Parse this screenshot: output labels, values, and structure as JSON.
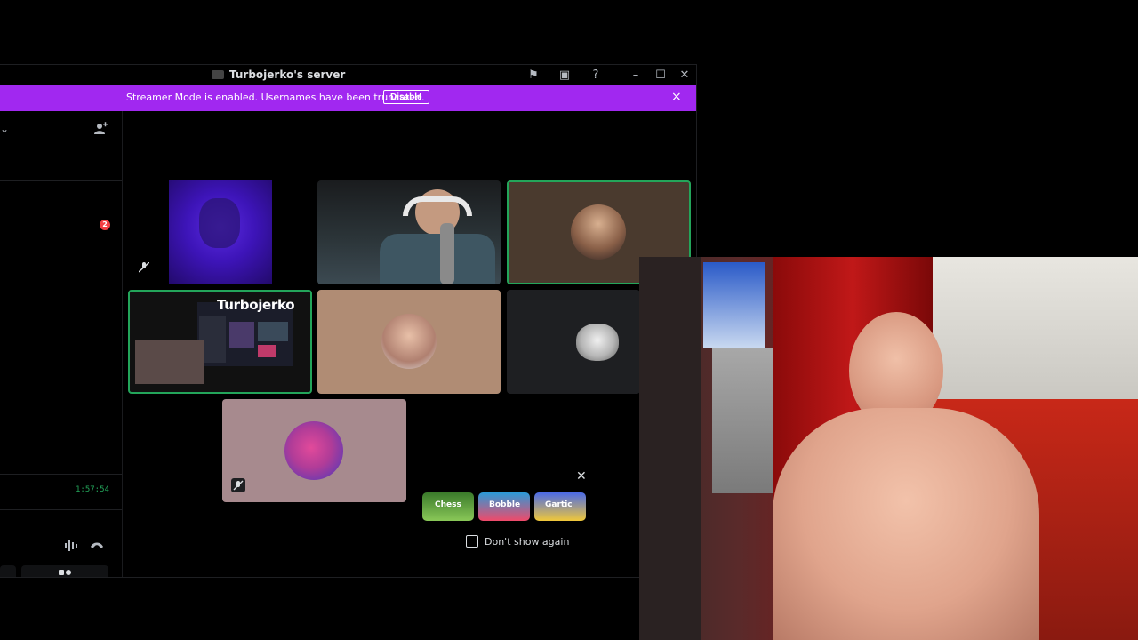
{
  "window": {
    "title": "Turbojerko's server",
    "banner_text": "Streamer Mode is enabled. Usernames have been truncated.",
    "banner_button": "Disable",
    "banner_close": "×"
  },
  "sidebar": {
    "notification_count": "2",
    "call_timer": "1:57:54"
  },
  "grid": {
    "stream_label": "Turbojerko"
  },
  "popup": {
    "dont_show_again": "Don't show again",
    "close": "✕",
    "games": [
      "Chess",
      "Bobble",
      "Gartic"
    ]
  },
  "icons": {
    "close": "✕",
    "minimize": "–",
    "maximize": "☐"
  }
}
